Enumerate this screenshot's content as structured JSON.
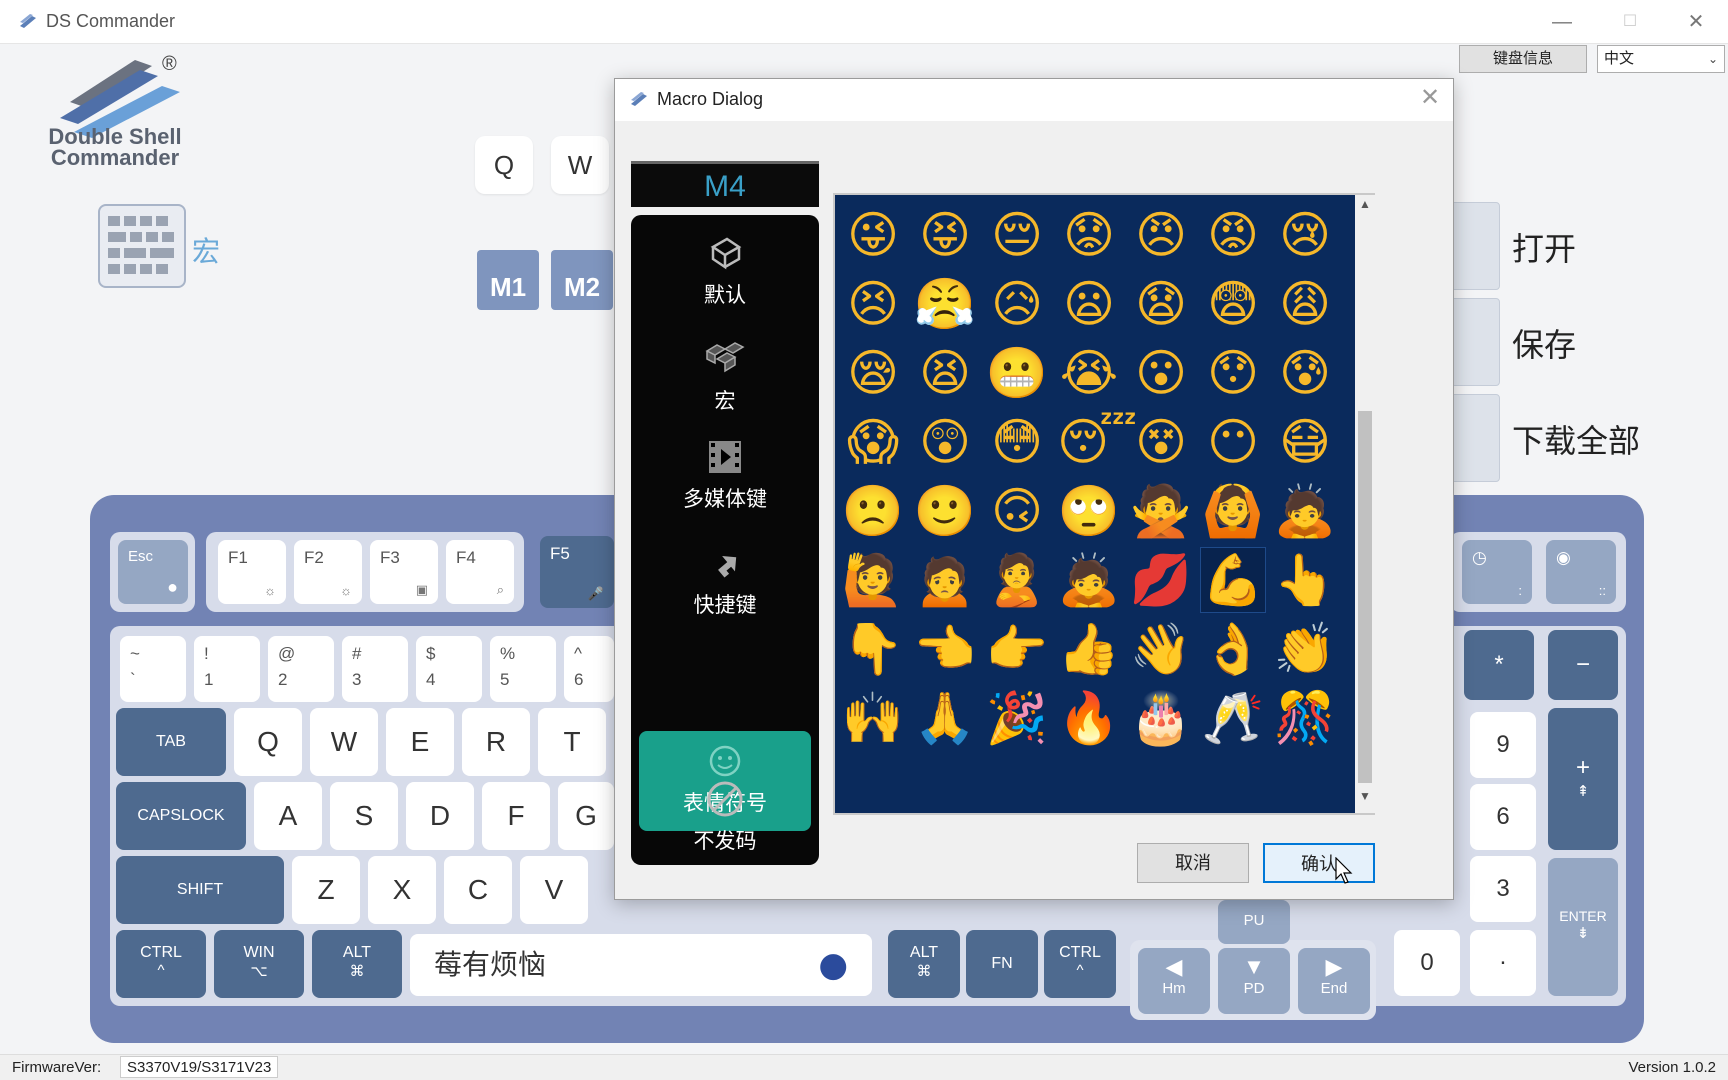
{
  "window": {
    "title": "DS Commander",
    "minimize": "—",
    "maximize": "☐",
    "close": "✕"
  },
  "toolbar": {
    "kbd_info_label": "键盘信息",
    "lang_value": "中文"
  },
  "logo": {
    "line1": "Double Shell",
    "line2": "Commander",
    "reg": "®"
  },
  "side_panel": {
    "macro_label": "宏"
  },
  "top_keys": [
    "Q",
    "W"
  ],
  "macro_tiles": [
    "M1",
    "M2"
  ],
  "side_actions": {
    "open": "打开",
    "save": "保存",
    "download_all": "下载全部"
  },
  "keyboard": {
    "fn_row": [
      {
        "main": "Esc",
        "sub": ""
      },
      {
        "main": "F1",
        "sub": "☼"
      },
      {
        "main": "F2",
        "sub": "☼"
      },
      {
        "main": "F3",
        "sub": "▣"
      },
      {
        "main": "F4",
        "sub": "⌕"
      },
      {
        "main": "F5",
        "sub": "🎤"
      }
    ],
    "num_row": [
      {
        "top": "~",
        "bottom": "`"
      },
      {
        "top": "!",
        "bottom": "1"
      },
      {
        "top": "@",
        "bottom": "2"
      },
      {
        "top": "#",
        "bottom": "3"
      },
      {
        "top": "$",
        "bottom": "4"
      },
      {
        "top": "%",
        "bottom": "5"
      },
      {
        "top": "^",
        "bottom": "6"
      }
    ],
    "row_q": [
      "TAB",
      "Q",
      "W",
      "E",
      "R",
      "T"
    ],
    "row_a": [
      "CAPSLOCK",
      "A",
      "S",
      "D",
      "F",
      "G"
    ],
    "row_z": [
      "SHIFT",
      "Z",
      "X",
      "C",
      "V"
    ],
    "bottom_left": [
      {
        "main": "CTRL",
        "sub": "^"
      },
      {
        "main": "WIN",
        "sub": "⌥"
      },
      {
        "main": "ALT",
        "sub": "⌘"
      }
    ],
    "spacebar_text": "莓有烦恼",
    "bottom_right": [
      {
        "main": "ALT",
        "sub": "⌘"
      },
      {
        "main": "FN",
        "sub": ""
      },
      {
        "main": "CTRL",
        "sub": "^"
      }
    ],
    "nav": [
      {
        "main": "◀",
        "sub": "Hm"
      },
      {
        "main": "▼",
        "sub": "PD"
      },
      {
        "main": "▶",
        "sub": "End"
      },
      {
        "main": "▲",
        "sub": "PU"
      }
    ],
    "numpad": {
      "star": "*",
      "minus": "−",
      "plus": "+",
      "plus_sub": "⇞",
      "n9": "9",
      "n6": "6",
      "n3": "3",
      "n0": "0",
      "dot": ".",
      "enter": "ENTER",
      "enter_sub": "⇟"
    }
  },
  "status": {
    "fw_label": "FirmwareVer:",
    "fw_value": "S3370V19/S3171V23",
    "version": "Version 1.0.2"
  },
  "dialog": {
    "title": "Macro Dialog",
    "close": "✕",
    "macro_slot": "M4",
    "menu": [
      {
        "label": "默认",
        "icon": "cube-icon"
      },
      {
        "label": "宏",
        "icon": "keycaps-icon"
      },
      {
        "label": "多媒体键",
        "icon": "film-icon"
      },
      {
        "label": "快捷键",
        "icon": "arrow-icon"
      },
      {
        "label": "表情符号",
        "icon": "emoji-icon",
        "active": true
      },
      {
        "label": "不发码",
        "icon": "no-icon"
      }
    ],
    "emoji_rows": [
      [
        "😜",
        "😝",
        "😔",
        "😟",
        "😠",
        "😡",
        "😢"
      ],
      [
        "😣",
        "😤",
        "😥",
        "😦",
        "😧",
        "😨",
        "😩"
      ],
      [
        "😪",
        "😫",
        "😬",
        "😭",
        "😮",
        "😯",
        "😰"
      ],
      [
        "😱",
        "😲",
        "😳",
        "😴",
        "😵",
        "😶",
        "😷"
      ],
      [
        "🙁",
        "🙂",
        "🙃",
        "🙄",
        "🙅",
        "🙆",
        "🙇"
      ],
      [
        "🙋",
        "🙍",
        "🙎",
        "🙇",
        "💋",
        "💪",
        "👆"
      ],
      [
        "👇",
        "👈",
        "👉",
        "👍",
        "👋",
        "👌",
        "👏"
      ],
      [
        "🙌",
        "🙏",
        "🎉",
        "🔥",
        "🎂",
        "🥂",
        "🎊"
      ]
    ],
    "selected_emoji": "💪",
    "cancel_label": "取消",
    "confirm_label": "确认",
    "scroll_up": "▲",
    "scroll_down": "▼"
  }
}
